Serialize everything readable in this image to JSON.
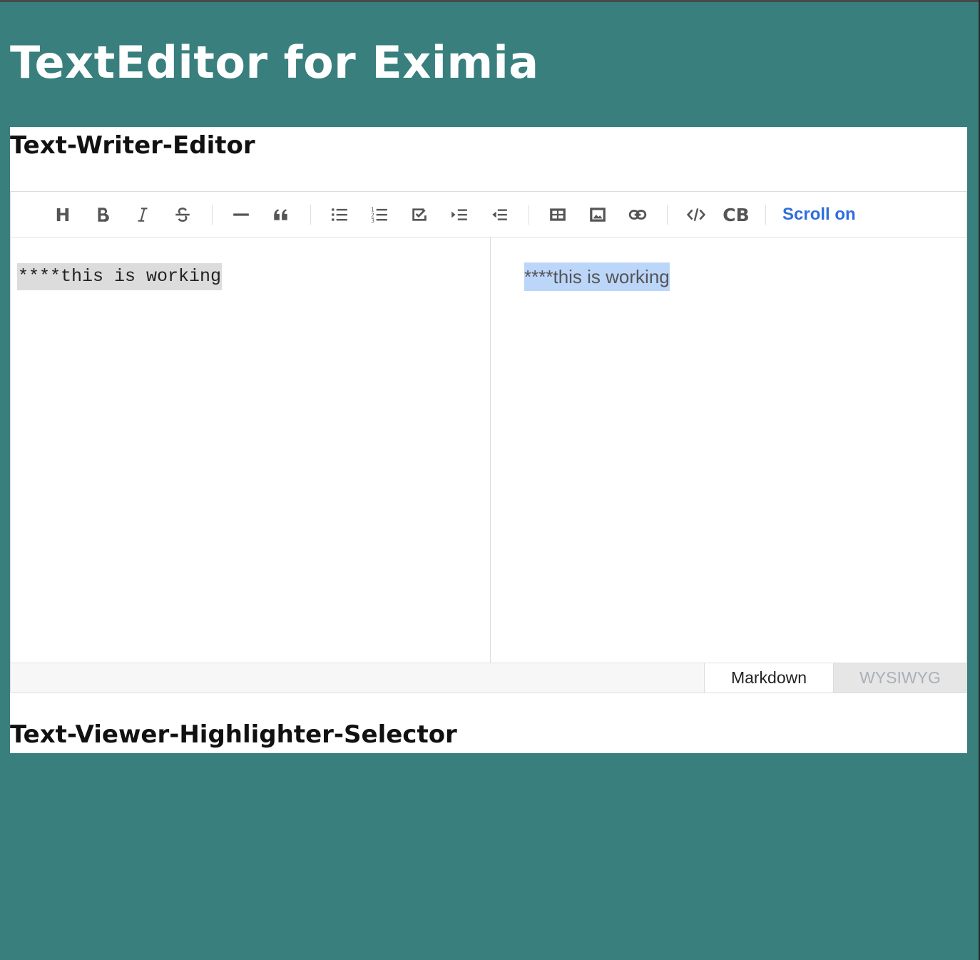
{
  "app": {
    "title": "TextEditor for Eximia"
  },
  "sections": {
    "writer_title": "Text-Writer-Editor",
    "viewer_title": "Text-Viewer-Highlighter-Selector"
  },
  "toolbar": {
    "heading_label": "H",
    "codeblock_label": "CB",
    "scroll_sync_label": "Scroll on",
    "icons": [
      "heading-icon",
      "bold-icon",
      "italic-icon",
      "strike-icon",
      "hr-icon",
      "quote-icon",
      "bullet-list-icon",
      "ordered-list-icon",
      "task-list-icon",
      "indent-icon",
      "outdent-icon",
      "table-icon",
      "image-icon",
      "link-icon",
      "code-icon",
      "codeblock-icon"
    ]
  },
  "editor": {
    "markdown_text": "****this is working",
    "preview_text": "****this is working"
  },
  "mode_tabs": {
    "markdown": "Markdown",
    "wysiwyg": "WYSIWYG",
    "active": "markdown"
  },
  "colors": {
    "background": "#387f7d",
    "panel": "#ffffff",
    "accent_link": "#2f6fdb",
    "selection_preview": "#bcd6fa",
    "selection_markdown": "#dcdcdc"
  }
}
